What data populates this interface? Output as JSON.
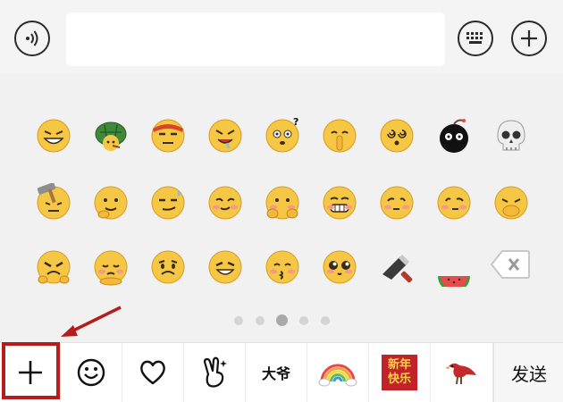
{
  "input_bar": {
    "voice_icon": "voice-icon",
    "text_value": "",
    "keyboard_icon": "keyboard-icon",
    "plus_icon": "plus-circle-icon"
  },
  "emoji_grid": {
    "rows": [
      [
        "grin",
        "turtle",
        "bandana-angry",
        "drool",
        "dizzy-question",
        "shush",
        "swirl-eyes",
        "bomb",
        "skull"
      ],
      [
        "hammer-hit",
        "hand-on-chin",
        "smirk-sweat",
        "sly",
        "cover-face",
        "teeth-grin",
        "look-left",
        "look-right",
        "facepalm"
      ],
      [
        "grumpy",
        "pout-hug",
        "sad",
        "squint-grin",
        "blush-kiss",
        "puppy-eyes",
        "kitchen-knife",
        "watermelon"
      ]
    ],
    "backspace_icon": "backspace-icon"
  },
  "pager": {
    "count": 5,
    "active": 2
  },
  "tabs": [
    {
      "icon": "plus-icon"
    },
    {
      "icon": "smiley-icon"
    },
    {
      "icon": "heart-icon"
    },
    {
      "icon": "victory-hand-icon"
    },
    {
      "icon": "dayeh-sticker-icon",
      "text": "大爷"
    },
    {
      "icon": "rainbow-icon"
    },
    {
      "icon": "new-year-sticker-icon",
      "lines": [
        "新年",
        "快乐"
      ]
    },
    {
      "icon": "red-bird-icon"
    }
  ],
  "send_label": "发送",
  "colors": {
    "emoji_yellow": "#f6c744",
    "highlight_red": "#b61c1c",
    "panel_bg": "#f1f1f1"
  }
}
